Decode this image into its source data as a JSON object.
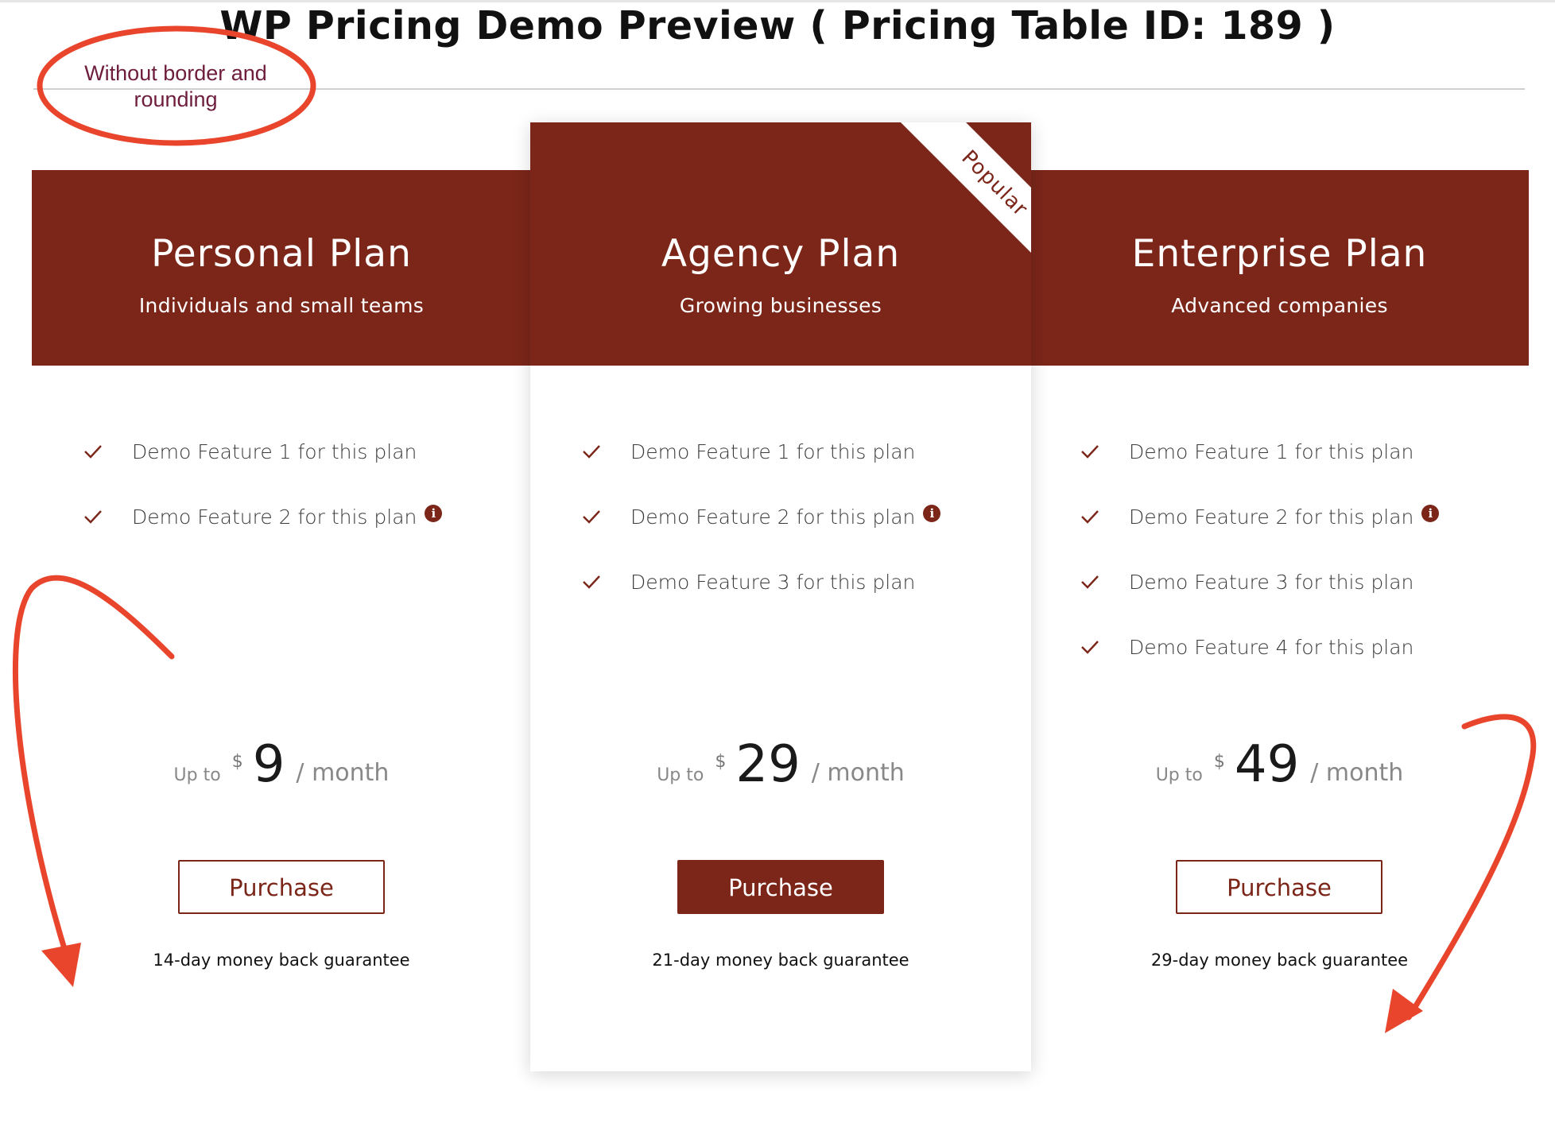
{
  "page": {
    "title": "WP Pricing Demo Preview ( Pricing Table ID: 189 )",
    "annotation_note": "Without border and rounding",
    "accent_color": "#7b2619",
    "annotation_color": "#e8452c"
  },
  "plans": [
    {
      "name": "Personal Plan",
      "subtitle": "Individuals and small teams",
      "features": [
        "Demo Feature 1 for this plan",
        "Demo Feature 2 for this plan"
      ],
      "price_prefix": "Up to",
      "currency": "$",
      "amount": "9",
      "period": "/ month",
      "button_label": "Purchase",
      "guarantee": "14-day money back guarantee"
    },
    {
      "name": "Agency Plan",
      "subtitle": "Growing businesses",
      "ribbon": "Popular",
      "features": [
        "Demo Feature 1 for this plan",
        "Demo Feature 2 for this plan",
        "Demo Feature 3 for this plan"
      ],
      "price_prefix": "Up to",
      "currency": "$",
      "amount": "29",
      "period": "/ month",
      "button_label": "Purchase",
      "guarantee": "21-day money back guarantee"
    },
    {
      "name": "Enterprise Plan",
      "subtitle": "Advanced companies",
      "features": [
        "Demo Feature 1 for this plan",
        "Demo Feature 2 for this plan",
        "Demo Feature 3 for this plan",
        "Demo Feature 4 for this plan"
      ],
      "price_prefix": "Up to",
      "currency": "$",
      "amount": "49",
      "period": "/ month",
      "button_label": "Purchase",
      "guarantee": "29-day money back guarantee"
    }
  ],
  "icons": {
    "check": "check-icon",
    "info": "info-icon",
    "info_glyph": "i"
  }
}
